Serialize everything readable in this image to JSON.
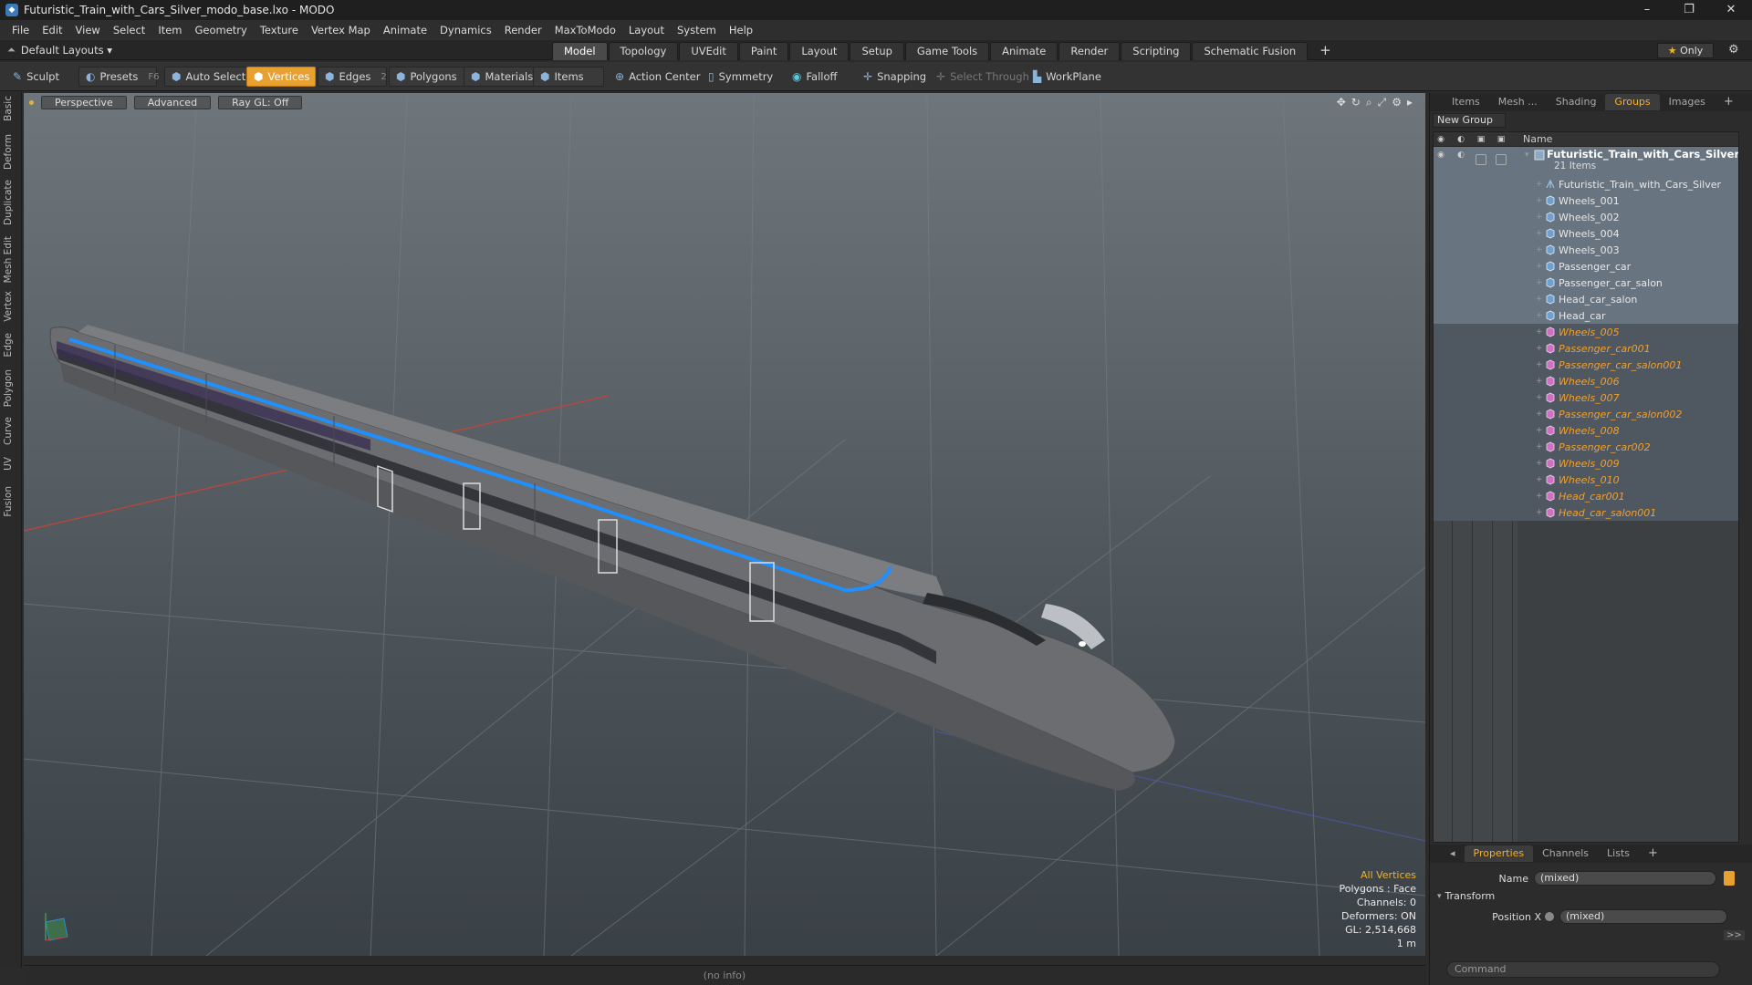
{
  "window": {
    "title": "Futuristic_Train_with_Cars_Silver_modo_base.lxo - MODO",
    "controls": [
      "–",
      "❐",
      "✕"
    ]
  },
  "menu": [
    "File",
    "Edit",
    "View",
    "Select",
    "Item",
    "Geometry",
    "Texture",
    "Vertex Map",
    "Animate",
    "Dynamics",
    "Render",
    "MaxToModo",
    "Layout",
    "System",
    "Help"
  ],
  "layouts": {
    "label": "Default Layouts ▾",
    "tabs": [
      "Model",
      "Topology",
      "UVEdit",
      "Paint",
      "Layout",
      "Setup",
      "Game Tools",
      "Animate",
      "Render",
      "Scripting",
      "Schematic Fusion"
    ],
    "active_tab": "Model",
    "add_tab": "+",
    "only_label": "Only"
  },
  "toolbar": {
    "sculpt": "Sculpt",
    "presets": "Presets",
    "presets_key": "F6",
    "auto_select": "Auto Select",
    "vertices": "Vertices",
    "vertices_count": "1",
    "edges": "Edges",
    "edges_count": "2",
    "polygons": "Polygons",
    "materials": "Materials",
    "items": "Items",
    "action_center": "Action Center",
    "symmetry": "Symmetry",
    "falloff": "Falloff",
    "snapping": "Snapping",
    "select_through": "Select Through",
    "workplane": "WorkPlane"
  },
  "left_tabs": [
    "Basic",
    "Deform",
    "Duplicate",
    "Mesh Edit",
    "Vertex",
    "Edge",
    "Polygon",
    "Curve",
    "UV",
    "Fusion"
  ],
  "viewport": {
    "view": "Perspective",
    "mode": "Advanced",
    "raygl": "Ray GL: Off",
    "stats": {
      "selection": "All Vertices",
      "polygons": "Polygons : Face",
      "channels": "Channels: 0",
      "deformers": "Deformers: ON",
      "gl": "GL: 2,514,668",
      "scale": "1 m"
    }
  },
  "status_bar": "(no info)",
  "right_panel": {
    "tabs": [
      "Items",
      "Mesh ...",
      "Shading",
      "Groups",
      "Images",
      "+"
    ],
    "active_tab": "Groups",
    "new_group": "New Group",
    "name_header": "Name",
    "group": {
      "name": "Futuristic_Train_with_Cars_Silver",
      "count": "21 Items"
    },
    "items": [
      {
        "name": "Futuristic_Train_with_Cars_Silver",
        "type": "locator",
        "state": "sel"
      },
      {
        "name": "Wheels_001",
        "type": "mesh",
        "state": "sel"
      },
      {
        "name": "Wheels_002",
        "type": "mesh",
        "state": "sel"
      },
      {
        "name": "Wheels_004",
        "type": "mesh",
        "state": "sel"
      },
      {
        "name": "Wheels_003",
        "type": "mesh",
        "state": "sel"
      },
      {
        "name": "Passenger_car",
        "type": "mesh",
        "state": "sel"
      },
      {
        "name": "Passenger_car_salon",
        "type": "mesh",
        "state": "sel"
      },
      {
        "name": "Head_car_salon",
        "type": "mesh",
        "state": "sel"
      },
      {
        "name": "Head_car",
        "type": "mesh",
        "state": "sel"
      },
      {
        "name": "Wheels_005",
        "type": "instance",
        "state": "band"
      },
      {
        "name": "Passenger_car001",
        "type": "instance",
        "state": "band"
      },
      {
        "name": "Passenger_car_salon001",
        "type": "instance",
        "state": "band"
      },
      {
        "name": "Wheels_006",
        "type": "instance",
        "state": "band"
      },
      {
        "name": "Wheels_007",
        "type": "instance",
        "state": "band"
      },
      {
        "name": "Passenger_car_salon002",
        "type": "instance",
        "state": "band"
      },
      {
        "name": "Wheels_008",
        "type": "instance",
        "state": "band"
      },
      {
        "name": "Passenger_car002",
        "type": "instance",
        "state": "band"
      },
      {
        "name": "Wheels_009",
        "type": "instance",
        "state": "band"
      },
      {
        "name": "Wheels_010",
        "type": "instance",
        "state": "band"
      },
      {
        "name": "Head_car001",
        "type": "instance",
        "state": "band"
      },
      {
        "name": "Head_car_salon001",
        "type": "instance",
        "state": "band"
      }
    ],
    "properties": {
      "tabs": [
        "Properties",
        "Channels",
        "Lists",
        "+"
      ],
      "active_tab": "Properties",
      "name_label": "Name",
      "name_value": "(mixed)",
      "section": "Transform",
      "position_label": "Position X",
      "position_value": "(mixed)",
      "more": ">>",
      "command_placeholder": "Command"
    }
  },
  "colors": {
    "accent": "#e8a030",
    "selection_row": "#687480",
    "instance_text": "#f0a030",
    "train_stripe": "#1e90ff"
  }
}
